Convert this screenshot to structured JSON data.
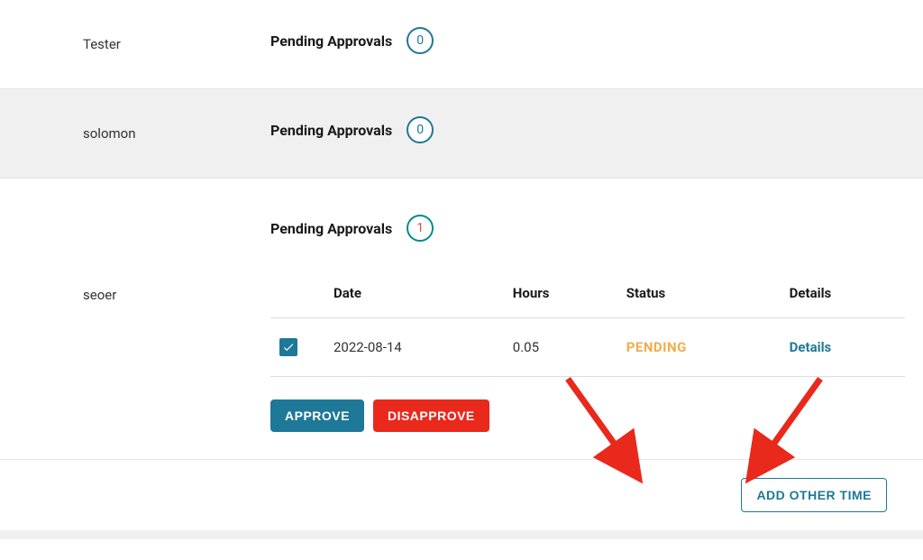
{
  "users": [
    {
      "name": "Tester",
      "pending_label": "Pending Approvals",
      "count": "0"
    },
    {
      "name": "solomon",
      "pending_label": "Pending Approvals",
      "count": "0"
    },
    {
      "name": "seoer",
      "pending_label": "Pending Approvals",
      "count": "1"
    }
  ],
  "table": {
    "headers": {
      "date": "Date",
      "hours": "Hours",
      "status": "Status",
      "details": "Details"
    },
    "rows": [
      {
        "date": "2022-08-14",
        "hours": "0.05",
        "status": "PENDING",
        "details": "Details"
      }
    ]
  },
  "actions": {
    "approve": "APPROVE",
    "disapprove": "DISAPPROVE",
    "add_other_time": "ADD OTHER TIME"
  }
}
